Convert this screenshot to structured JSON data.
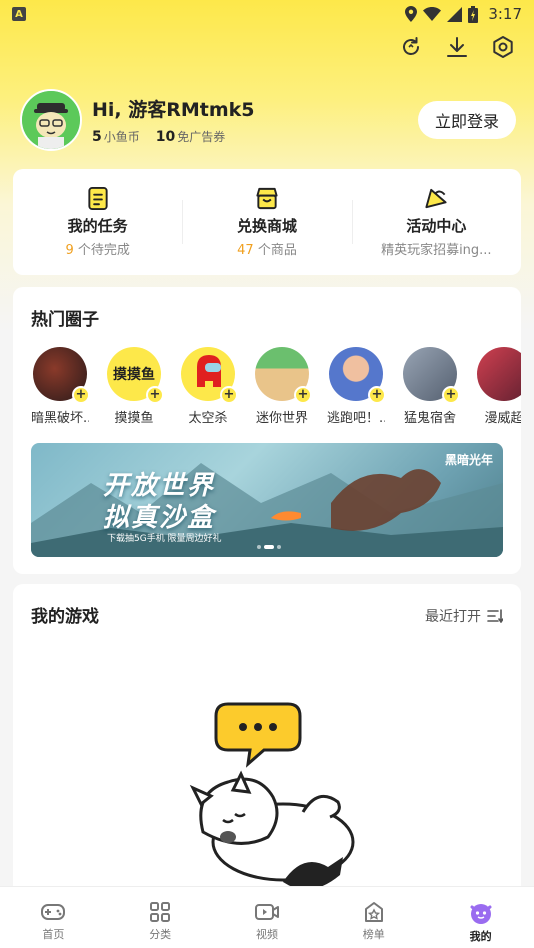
{
  "status_bar": {
    "time": "3:17",
    "app_badge": "A"
  },
  "profile": {
    "greeting": "Hi, 游客RMtmk5",
    "coins_value": "5",
    "coins_label": "小鱼币",
    "coupons_value": "10",
    "coupons_label": "免广告券",
    "login_label": "立即登录"
  },
  "quick_actions": [
    {
      "title": "我的任务",
      "count": "9",
      "sub": "个待完成",
      "icon": "task-icon"
    },
    {
      "title": "兑换商城",
      "count": "47",
      "sub": "个商品",
      "icon": "shop-icon"
    },
    {
      "title": "活动中心",
      "count": "",
      "sub": "精英玩家招募ing...",
      "icon": "activity-icon"
    }
  ],
  "circles": {
    "title": "热门圈子",
    "items": [
      {
        "name": "暗黑破坏...",
        "color": "#3a2a2a"
      },
      {
        "name": "摸摸鱼",
        "color": "#fde84a",
        "text": "摸摸鱼"
      },
      {
        "name": "太空杀",
        "color": "#fde84a"
      },
      {
        "name": "迷你世界",
        "color": "#6bbf6e"
      },
      {
        "name": "逃跑吧！...",
        "color": "#5577cc"
      },
      {
        "name": "猛鬼宿舍",
        "color": "#667788"
      },
      {
        "name": "漫威超",
        "color": "#b33344"
      }
    ],
    "banner": {
      "line1": "开放世界",
      "line2": "拟真沙盒",
      "sub": "下载抽5G手机 限量周边好礼",
      "logo": "黑暗光年"
    }
  },
  "games": {
    "title": "我的游戏",
    "recent_label": "最近打开"
  },
  "tabbar": [
    {
      "label": "首页",
      "icon": "gamepad-icon",
      "active": false
    },
    {
      "label": "分类",
      "icon": "grid-icon",
      "active": false
    },
    {
      "label": "视频",
      "icon": "video-icon",
      "active": false
    },
    {
      "label": "榜单",
      "icon": "ranking-icon",
      "active": false
    },
    {
      "label": "我的",
      "icon": "mine-icon",
      "active": true
    }
  ],
  "colors": {
    "accent": "#fde84a",
    "highlight": "#f0a020"
  }
}
